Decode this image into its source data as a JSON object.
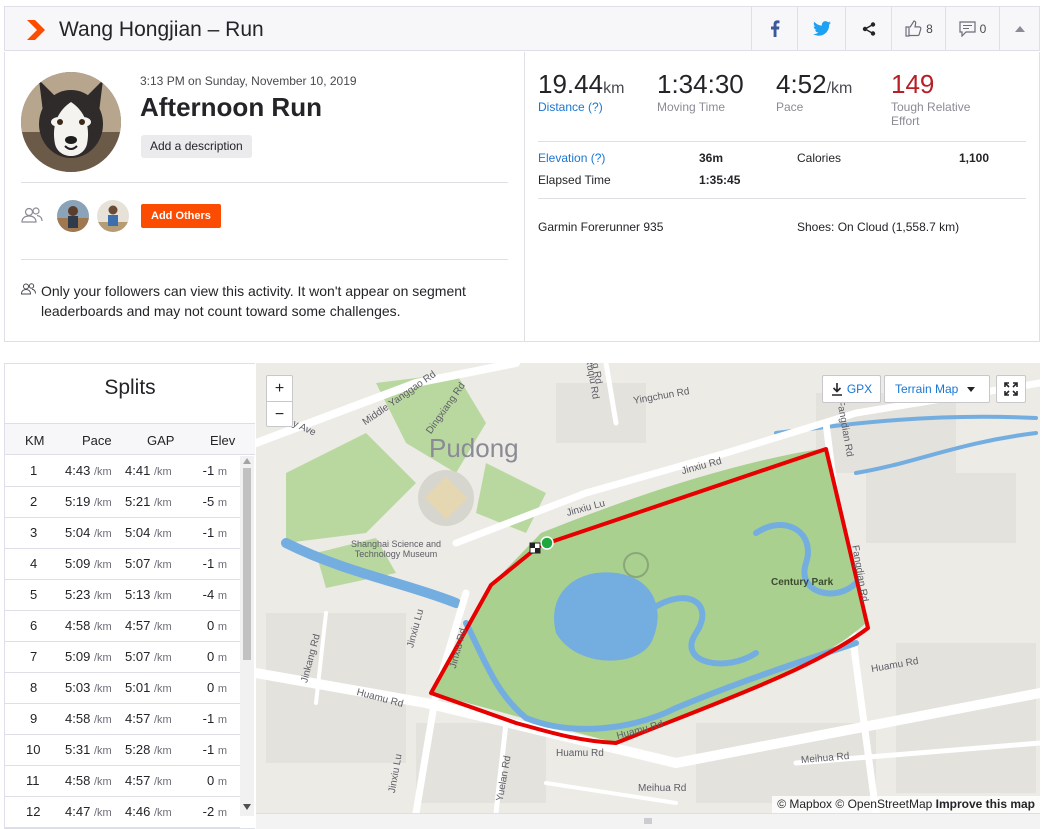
{
  "header": {
    "title": "Wang Hongjian – Run",
    "kudos_count": "8",
    "comment_count": "0"
  },
  "activity": {
    "date_time": "3:13 PM on Sunday, November 10, 2019",
    "name": "Afternoon Run",
    "add_description": "Add a description",
    "add_others": "Add Others",
    "privacy_note": "Only your followers can view this activity. It won't appear on segment leaderboards and may not count toward some challenges."
  },
  "stats": {
    "distance": {
      "value": "19.44",
      "unit": "km",
      "label": "Distance (?)"
    },
    "moving_time": {
      "value": "1:34:30",
      "label": "Moving Time"
    },
    "pace": {
      "value": "4:52",
      "unit": "/km",
      "label": "Pace"
    },
    "relative_effort": {
      "value": "149",
      "label_line1": "Tough Relative",
      "label_line2": "Effort"
    }
  },
  "details": {
    "elevation_label": "Elevation (?)",
    "elevation_value": "36m",
    "calories_label": "Calories",
    "calories_value": "1,100",
    "elapsed_label": "Elapsed Time",
    "elapsed_value": "1:35:45",
    "device": "Garmin Forerunner 935",
    "shoes": "Shoes: On Cloud (1,558.7 km)"
  },
  "splits": {
    "title": "Splits",
    "columns": [
      "KM",
      "Pace",
      "GAP",
      "Elev"
    ],
    "pace_unit": "/km",
    "elev_unit": "m",
    "rows": [
      {
        "km": "1",
        "pace": "4:43",
        "gap": "4:41",
        "elev": "-1"
      },
      {
        "km": "2",
        "pace": "5:19",
        "gap": "5:21",
        "elev": "-5"
      },
      {
        "km": "3",
        "pace": "5:04",
        "gap": "5:04",
        "elev": "-1"
      },
      {
        "km": "4",
        "pace": "5:09",
        "gap": "5:07",
        "elev": "-1"
      },
      {
        "km": "5",
        "pace": "5:23",
        "gap": "5:13",
        "elev": "-4"
      },
      {
        "km": "6",
        "pace": "4:58",
        "gap": "4:57",
        "elev": "0"
      },
      {
        "km": "7",
        "pace": "5:09",
        "gap": "5:07",
        "elev": "0"
      },
      {
        "km": "8",
        "pace": "5:03",
        "gap": "5:01",
        "elev": "0"
      },
      {
        "km": "9",
        "pace": "4:58",
        "gap": "4:57",
        "elev": "-1"
      },
      {
        "km": "10",
        "pace": "5:31",
        "gap": "5:28",
        "elev": "-1"
      },
      {
        "km": "11",
        "pace": "4:58",
        "gap": "4:57",
        "elev": "0"
      },
      {
        "km": "12",
        "pace": "4:47",
        "gap": "4:46",
        "elev": "-2"
      }
    ]
  },
  "map": {
    "zoom_in": "+",
    "zoom_out": "−",
    "gpx_label": "GPX",
    "terrain_label": "Terrain Map",
    "attribution_mapbox": "© Mapbox",
    "attribution_osm": "© OpenStreetMap",
    "attribution_improve": "Improve this map",
    "labels": {
      "pudong": "Pudong",
      "museum": "Shanghai Science and Technology Museum",
      "century_park": "Century Park",
      "middle_yanggao": "Middle Yanggao Rd",
      "dingxiang": "Dingxiang Rd",
      "jinxiu1": "Jinxiu Lu",
      "jinxiu2": "Jinxiu Lu",
      "jinxiu_rd": "Jinxiu Rd",
      "fangdian1": "Fangdian Rd",
      "fangdian2": "Fangdian Rd",
      "huamu1": "Huamu Rd",
      "huamu2": "Huamu Rd",
      "huamu3": "Huamu Rd",
      "huamu4": "Huamu Rd",
      "jinxiu_lu_v": "Jinxiu Lu",
      "jinxiu_rd_v": "Jinxiu Rd",
      "jinkang": "Jinkang Rd",
      "yuelan": "Yuelan Rd",
      "ruqiu": "Ruqiu Rd",
      "yingchun": "Yingchun Rd",
      "meihua1": "Meihua Rd",
      "meihua2": "Meihua Rd",
      "ave": "y Ave",
      "g_rd": "g Rd",
      "jinxiu_lu_s": "Jinxiu Lu"
    }
  },
  "colors": {
    "brand": "#fc4c02",
    "link": "#1a76d2",
    "effort": "#b52126",
    "route": "#e60000",
    "park": "#a9d08e",
    "water": "#74aee0"
  }
}
